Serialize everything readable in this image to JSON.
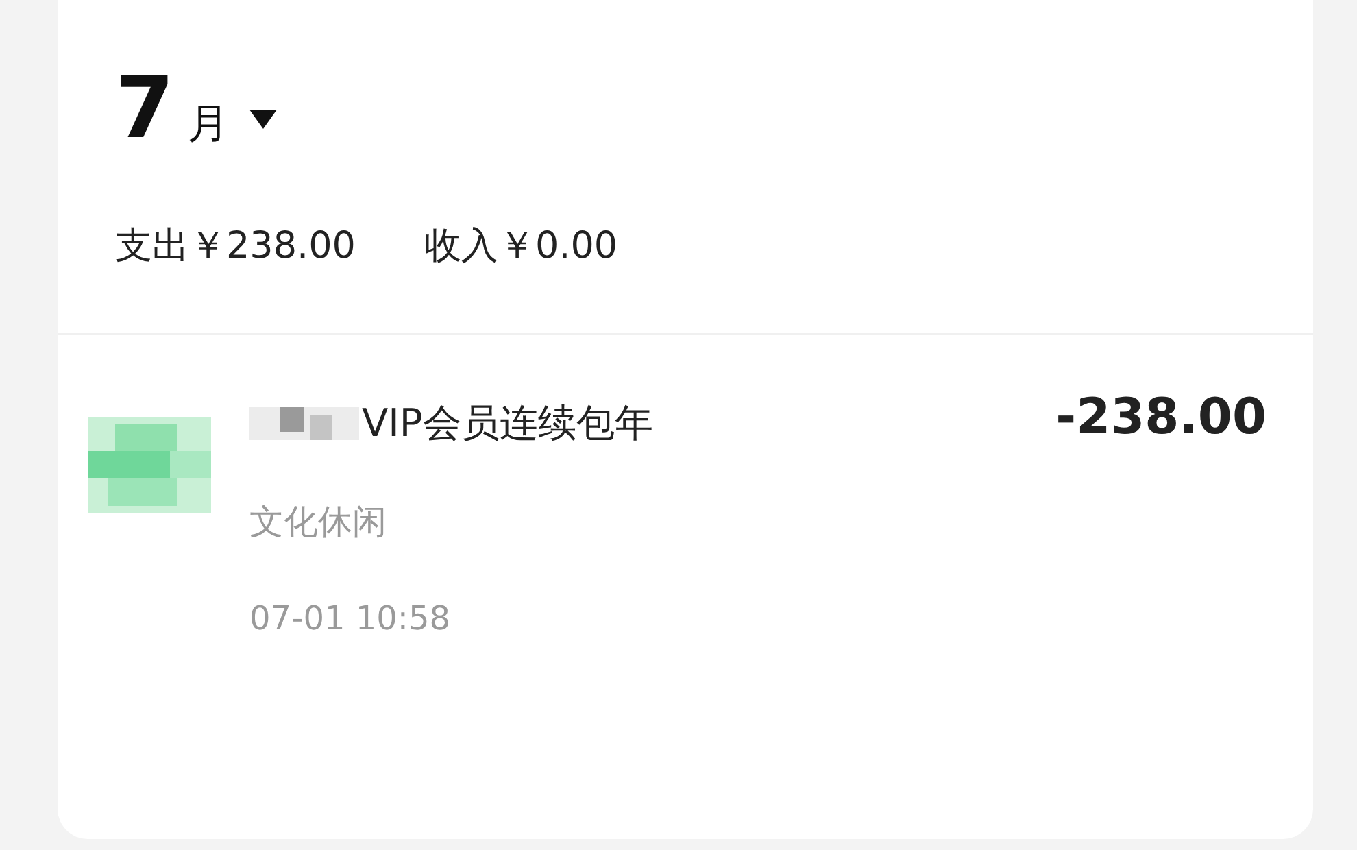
{
  "header": {
    "month_number": "7",
    "month_unit": "月"
  },
  "summary": {
    "expense": "支出￥238.00",
    "income": "收入￥0.00"
  },
  "transactions": [
    {
      "title": "VIP会员连续包年",
      "amount": "-238.00",
      "category": "文化休闲",
      "time": "07-01 10:58"
    }
  ]
}
